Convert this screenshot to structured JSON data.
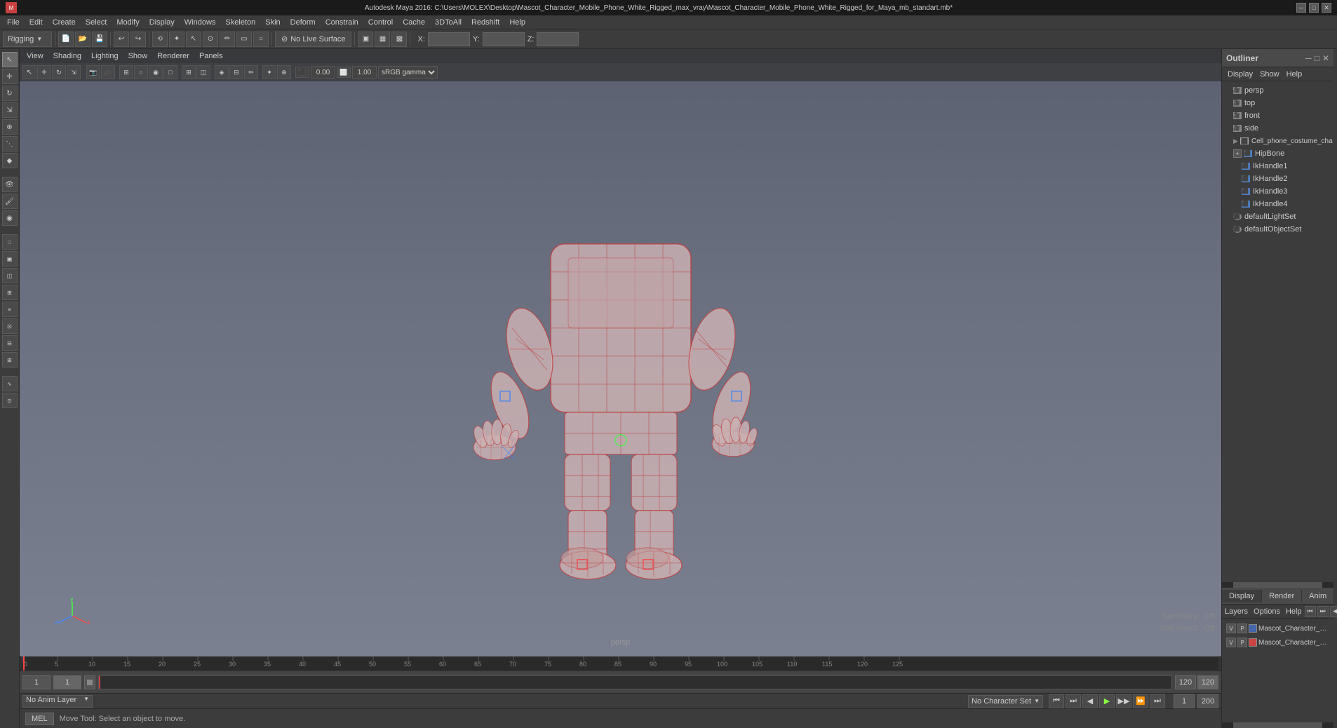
{
  "titlebar": {
    "text": "Autodesk Maya 2016: C:\\Users\\MOLEX\\Desktop\\Mascot_Character_Mobile_Phone_White_Rigged_max_vray\\Mascot_Character_Mobile_Phone_White_Rigged_for_Maya_mb_standart.mb*",
    "minimize": "─",
    "maximize": "□",
    "close": "✕"
  },
  "menubar": {
    "items": [
      "File",
      "Edit",
      "Create",
      "Select",
      "Modify",
      "Display",
      "Windows",
      "Skeleton",
      "Skin",
      "Deform",
      "Constrain",
      "Control",
      "Cache",
      "3DtoAll",
      "Redshift",
      "Help"
    ]
  },
  "toolbar1": {
    "mode_dropdown": "Rigging",
    "no_live_surface": "No Live Surface",
    "x_label": "X:",
    "y_label": "Y:",
    "z_label": "Z:"
  },
  "viewport_menu": {
    "items": [
      "View",
      "Shading",
      "Lighting",
      "Show",
      "Renderer",
      "Panels"
    ]
  },
  "viewport": {
    "perspective_label": "persp",
    "symmetry_label": "Symmetry:",
    "symmetry_value": "Off",
    "soft_select_label": "Soft Select:",
    "soft_select_value": "Off",
    "gamma_label": "sRGB gamma",
    "color_value": "0.00",
    "other_value": "1.00"
  },
  "outliner": {
    "title": "Outliner",
    "menu_items": [
      "Display",
      "Show",
      "Help"
    ],
    "items": [
      {
        "name": "persp",
        "type": "camera",
        "indent": 1
      },
      {
        "name": "top",
        "type": "camera",
        "indent": 1
      },
      {
        "name": "front",
        "type": "camera",
        "indent": 1
      },
      {
        "name": "side",
        "type": "camera",
        "indent": 1
      },
      {
        "name": "Cell_phone_costume_cha",
        "type": "mesh",
        "indent": 1
      },
      {
        "name": "HipBone",
        "type": "bone",
        "indent": 1,
        "expanded": true
      },
      {
        "name": "IkHandle1",
        "type": "ik",
        "indent": 2
      },
      {
        "name": "IkHandle2",
        "type": "ik",
        "indent": 2
      },
      {
        "name": "IkHandle3",
        "type": "ik",
        "indent": 2
      },
      {
        "name": "IkHandle4",
        "type": "ik",
        "indent": 2
      },
      {
        "name": "defaultLightSet",
        "type": "set",
        "indent": 1
      },
      {
        "name": "defaultObjectSet",
        "type": "set",
        "indent": 1
      }
    ]
  },
  "lower_right": {
    "tabs": [
      "Display",
      "Render",
      "Anim"
    ],
    "active_tab": "Display",
    "menu_items": [
      "Layers",
      "Options",
      "Help"
    ],
    "layers": [
      {
        "v": true,
        "p": true,
        "color": "#4466aa",
        "name": "Mascot_Character_Mobile_P"
      },
      {
        "v": true,
        "p": true,
        "color": "#cc4444",
        "name": "Mascot_Character_Mo"
      }
    ]
  },
  "timeline": {
    "start_frame": "1",
    "current_frame": "1",
    "playback_start": "1",
    "end_frame": "120",
    "playback_end": "120",
    "max_end": "200"
  },
  "anim_bar": {
    "anim_layer_label": "No Anim Layer",
    "char_set_label": "No Character Set"
  },
  "status_bar": {
    "mel_label": "MEL",
    "message": "Move Tool: Select an object to move."
  },
  "playback": {
    "buttons": [
      "⏮",
      "⏭",
      "◀",
      "▶",
      "⏹",
      "▶",
      "⏩",
      "⏭"
    ]
  }
}
